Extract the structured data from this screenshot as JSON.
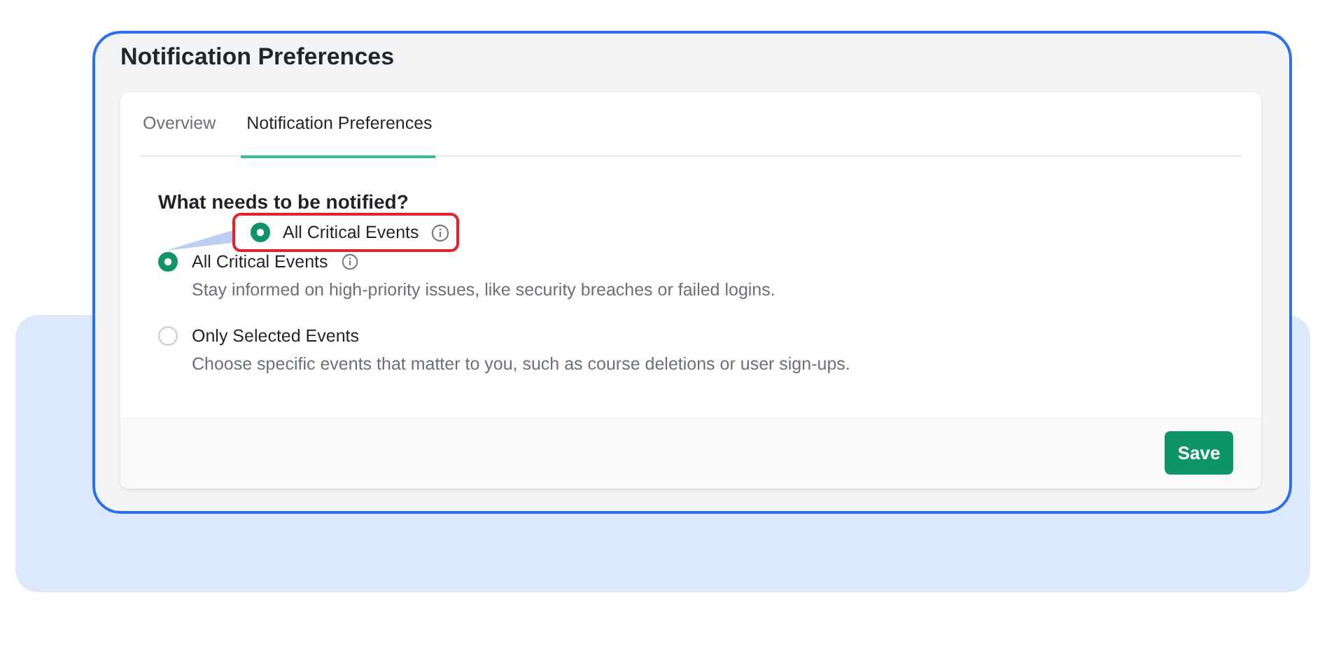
{
  "panel": {
    "title": "Notification Preferences"
  },
  "tabs": [
    {
      "label": "Overview",
      "selected": false
    },
    {
      "label": "Notification Preferences",
      "selected": true
    }
  ],
  "question": "What needs to be notified?",
  "options": [
    {
      "label": "All Critical Events",
      "description": "Stay informed on high-priority issues, like security breaches or failed logins.",
      "selected": true,
      "info": true
    },
    {
      "label": "Only Selected Events",
      "description": "Choose specific events that matter to you, such as course deletions or user sign-ups.",
      "selected": false,
      "info": false
    }
  ],
  "callout": {
    "label": "All Critical Events",
    "selected": true,
    "info": true
  },
  "buttons": [
    {
      "label": "Save"
    }
  ]
}
